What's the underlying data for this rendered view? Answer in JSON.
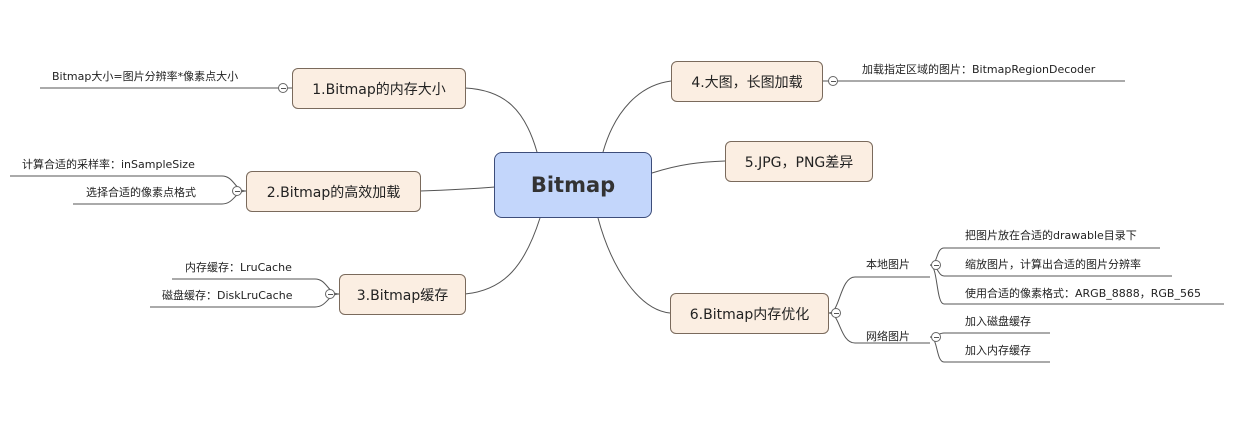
{
  "center": "Bitmap",
  "topics": {
    "t1": "1.Bitmap的内存大小",
    "t2": "2.Bitmap的高效加载",
    "t3": "3.Bitmap缓存",
    "t4": "4.大图，长图加载",
    "t5": "5.JPG，PNG差异",
    "t6": "6.Bitmap内存优化"
  },
  "leaves": {
    "t1_a": "Bitmap大小=图片分辨率*像素点大小",
    "t2_a": "计算合适的采样率：inSampleSize",
    "t2_b": "选择合适的像素点格式",
    "t3_a": "内存缓存：LruCache",
    "t3_b": "磁盘缓存：DiskLruCache",
    "t4_a": "加载指定区域的图片：BitmapRegionDecoder",
    "t6_local": "本地图片",
    "t6_local_a": "把图片放在合适的drawable目录下",
    "t6_local_b": "缩放图片，计算出合适的图片分辨率",
    "t6_local_c": "使用合适的像素格式：ARGB_8888，RGB_565",
    "t6_net": "网络图片",
    "t6_net_a": "加入磁盘缓存",
    "t6_net_b": "加入内存缓存"
  }
}
